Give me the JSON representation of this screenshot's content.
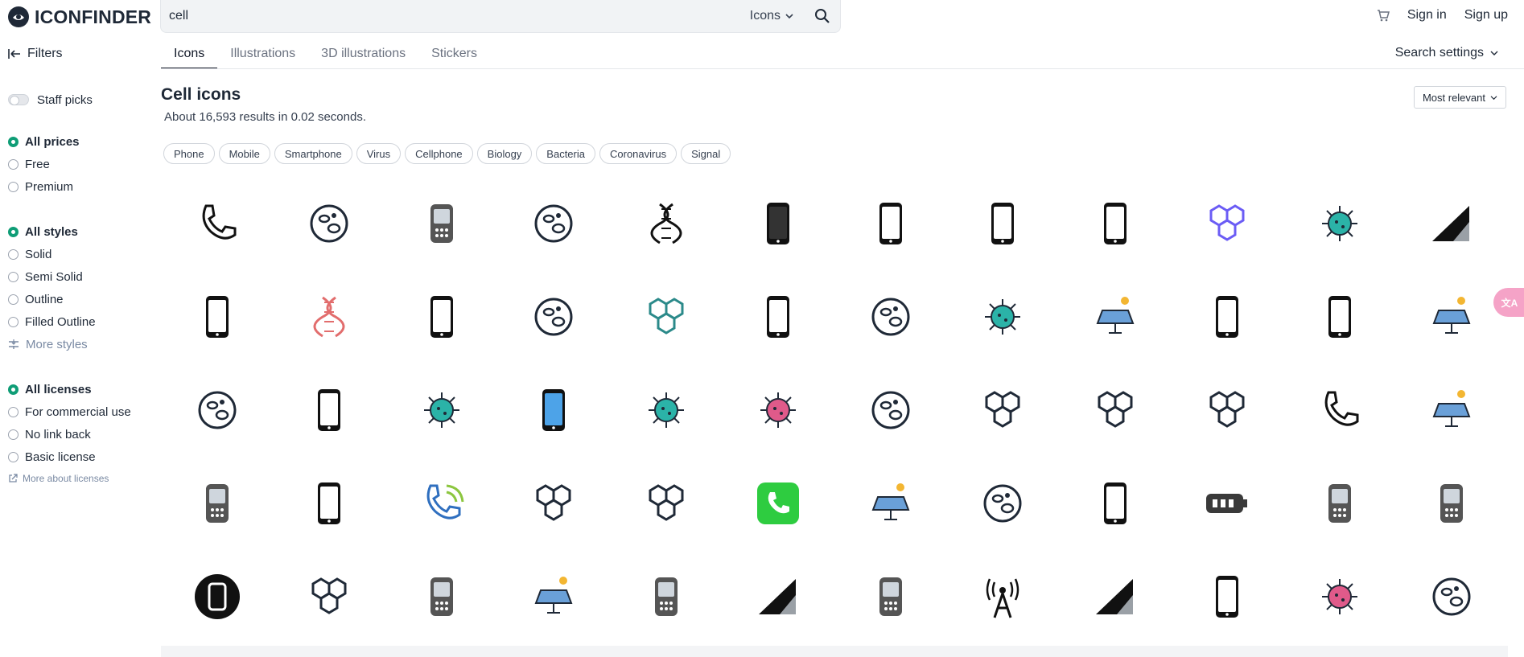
{
  "brand": {
    "name": "ICONFINDER"
  },
  "search": {
    "query": "cell",
    "type_label": "Icons"
  },
  "header": {
    "sign_in": "Sign in",
    "sign_up": "Sign up"
  },
  "nav": {
    "filters_label": "Filters",
    "tabs": [
      {
        "label": "Icons",
        "active": true
      },
      {
        "label": "Illustrations",
        "active": false
      },
      {
        "label": "3D illustrations",
        "active": false
      },
      {
        "label": "Stickers",
        "active": false
      }
    ],
    "search_settings": "Search settings"
  },
  "sidebar": {
    "staff_picks": "Staff picks",
    "prices": [
      "All prices",
      "Free",
      "Premium"
    ],
    "styles": [
      "All styles",
      "Solid",
      "Semi Solid",
      "Outline",
      "Filled Outline"
    ],
    "more_styles": "More styles",
    "licenses": [
      "All licenses",
      "For commercial use",
      "No link back",
      "Basic license"
    ],
    "more_licenses": "More about licenses"
  },
  "main": {
    "title": "Cell icons",
    "results": "About 16,593 results in 0.02 seconds.",
    "sort": "Most relevant",
    "chips": [
      "Phone",
      "Mobile",
      "Smartphone",
      "Virus",
      "Cellphone",
      "Biology",
      "Bacteria",
      "Coronavirus",
      "Signal"
    ]
  },
  "icons": [
    "phone-ringing-icon",
    "cell-cluster-icon",
    "tablet-device-icon",
    "neuron-cell-icon",
    "dna-helix-icon",
    "dark-smartphone-icon",
    "smartphone-signal-icon",
    "smartphone-signal-icon",
    "smartphone-signal-icon",
    "hexagon-molecule-icon",
    "teal-virus-pair-icon",
    "signal-strength-icon",
    "two-phones-icon",
    "red-dna-icon",
    "outline-smartphone-icon",
    "petri-dish-icon",
    "honeycomb-cells-icon",
    "phone-vibrate-icon",
    "cell-division-icon",
    "teal-virus-icon",
    "solar-panel-bulbs-icon",
    "black-smartphone-icon",
    "gray-smartphone-icon",
    "solar-tower-icon",
    "neuron-outline-icon",
    "phone-heart-icon",
    "teal-bacteria-icon",
    "blue-screen-phone-icon",
    "teal-virus-pair-icon",
    "pink-cancer-cell-icon",
    "microscope-cell-icon",
    "molecule-structure-icon",
    "network-nodes-icon",
    "hexagon-network-icon",
    "phone-handset-icon",
    "solar-panel-sun-icon",
    "walkie-talkie-icon",
    "mobile-outline-icon",
    "phone-call-signal-icon",
    "honeycomb-gems-icon",
    "molecule-nodes-icon",
    "green-phone-app-icon",
    "solar-panel-color-icon",
    "head-chromosome-icon",
    "mobile-thin-icon",
    "battery-icon",
    "keypad-phone-icon",
    "tablet-gray-icon",
    "phone-circle-icon",
    "flask-molecule-icon",
    "calculator-phone-icon",
    "solar-house-icon",
    "feature-phone-icon",
    "no-signal-icon",
    "flip-phone-icon",
    "radio-tower-icon",
    "signal-triangle-icon",
    "smartphone-bold-icon",
    "pink-virus-icon",
    "magnifier-cells-icon"
  ],
  "colors": {
    "accent": "#0f9d76",
    "teal": "#2bb3a8",
    "link": "#7a8aa3"
  }
}
